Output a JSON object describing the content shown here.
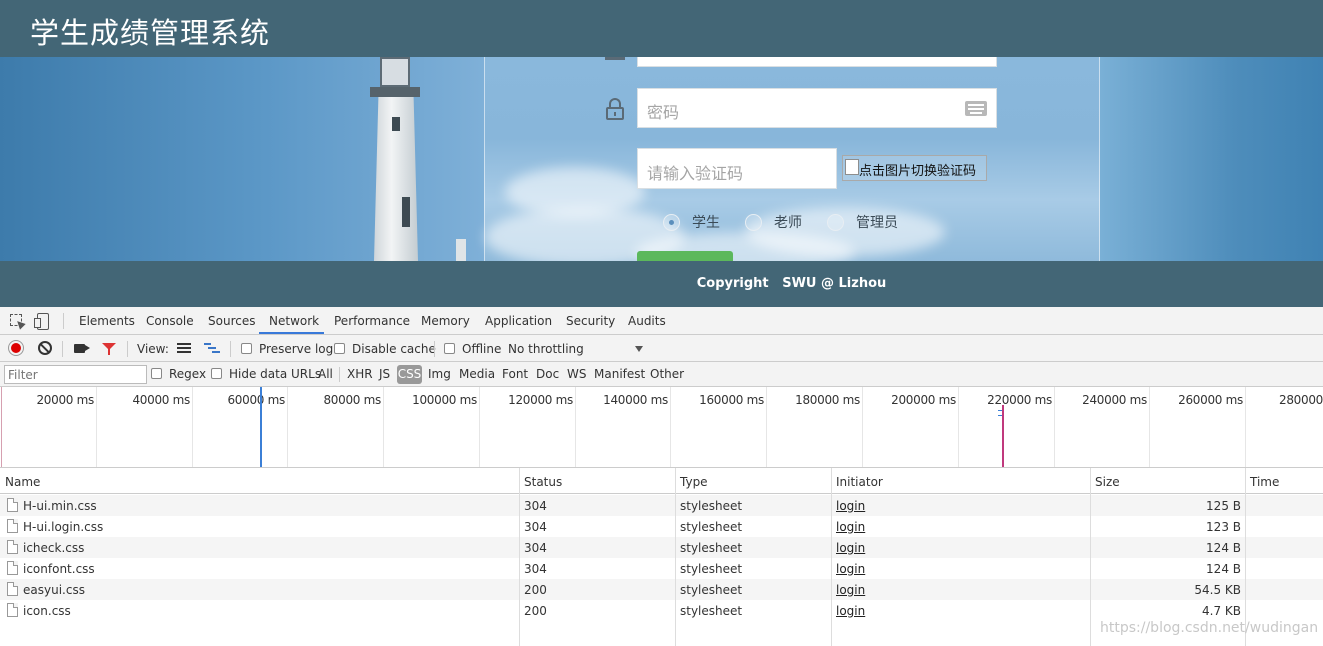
{
  "app": {
    "title": "学生成绩管理系统",
    "password_placeholder": "密码",
    "captcha_placeholder": "请输入验证码",
    "captcha_alt": "点击图片切换验证码",
    "roles": [
      {
        "label": "学生",
        "checked": true
      },
      {
        "label": "老师",
        "checked": false
      },
      {
        "label": "管理员",
        "checked": false
      }
    ],
    "footer": "Copyright   SWU @ Lizhou"
  },
  "devtools": {
    "tabs": [
      "Elements",
      "Console",
      "Sources",
      "Network",
      "Performance",
      "Memory",
      "Application",
      "Security",
      "Audits"
    ],
    "active_tab": "Network",
    "toolbar": {
      "view_label": "View:",
      "preserve_log": "Preserve log",
      "disable_cache": "Disable cache",
      "offline": "Offline",
      "throttling": "No throttling"
    },
    "filter_bar": {
      "placeholder": "Filter",
      "regex": "Regex",
      "hide_data_urls": "Hide data URLs",
      "types": [
        "All",
        "XHR",
        "JS",
        "CSS",
        "Img",
        "Media",
        "Font",
        "Doc",
        "WS",
        "Manifest",
        "Other"
      ],
      "active_type": "CSS"
    },
    "overview_ticks": [
      "20000 ms",
      "40000 ms",
      "60000 ms",
      "80000 ms",
      "100000 ms",
      "120000 ms",
      "140000 ms",
      "160000 ms",
      "180000 ms",
      "200000 ms",
      "220000 ms",
      "240000 ms",
      "260000 ms",
      "280000"
    ],
    "columns": [
      "Name",
      "Status",
      "Type",
      "Initiator",
      "Size",
      "Time"
    ],
    "requests": [
      {
        "name": "H-ui.min.css",
        "status": "304",
        "type": "stylesheet",
        "initiator": "login",
        "size": "125 B"
      },
      {
        "name": "H-ui.login.css",
        "status": "304",
        "type": "stylesheet",
        "initiator": "login",
        "size": "123 B"
      },
      {
        "name": "icheck.css",
        "status": "304",
        "type": "stylesheet",
        "initiator": "login",
        "size": "124 B"
      },
      {
        "name": "iconfont.css",
        "status": "304",
        "type": "stylesheet",
        "initiator": "login",
        "size": "124 B"
      },
      {
        "name": "easyui.css",
        "status": "200",
        "type": "stylesheet",
        "initiator": "login",
        "size": "54.5 KB"
      },
      {
        "name": "icon.css",
        "status": "200",
        "type": "stylesheet",
        "initiator": "login",
        "size": "4.7 KB"
      }
    ]
  },
  "watermark": "https://blog.csdn.net/wudingan",
  "colors": {
    "header_bg": "#436676",
    "accent_blue": "#3879d9",
    "record_red": "#dd0000",
    "login_green": "#5cb85c"
  }
}
